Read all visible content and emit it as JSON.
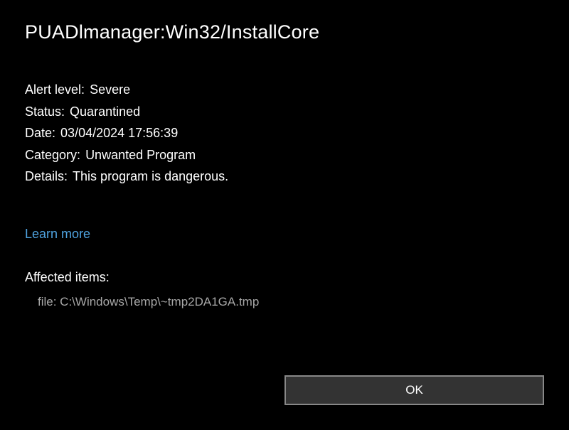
{
  "threat": {
    "name": "PUADlmanager:Win32/InstallCore"
  },
  "details": {
    "alert_level_label": "Alert level:",
    "alert_level_value": "Severe",
    "status_label": "Status:",
    "status_value": "Quarantined",
    "date_label": "Date:",
    "date_value": "03/04/2024 17:56:39",
    "category_label": "Category:",
    "category_value": "Unwanted Program",
    "details_label": "Details:",
    "details_value": "This program is dangerous."
  },
  "learn_more": "Learn more",
  "affected": {
    "header": "Affected items:",
    "items": [
      "file: C:\\Windows\\Temp\\~tmp2DA1GA.tmp"
    ]
  },
  "buttons": {
    "ok": "OK"
  }
}
